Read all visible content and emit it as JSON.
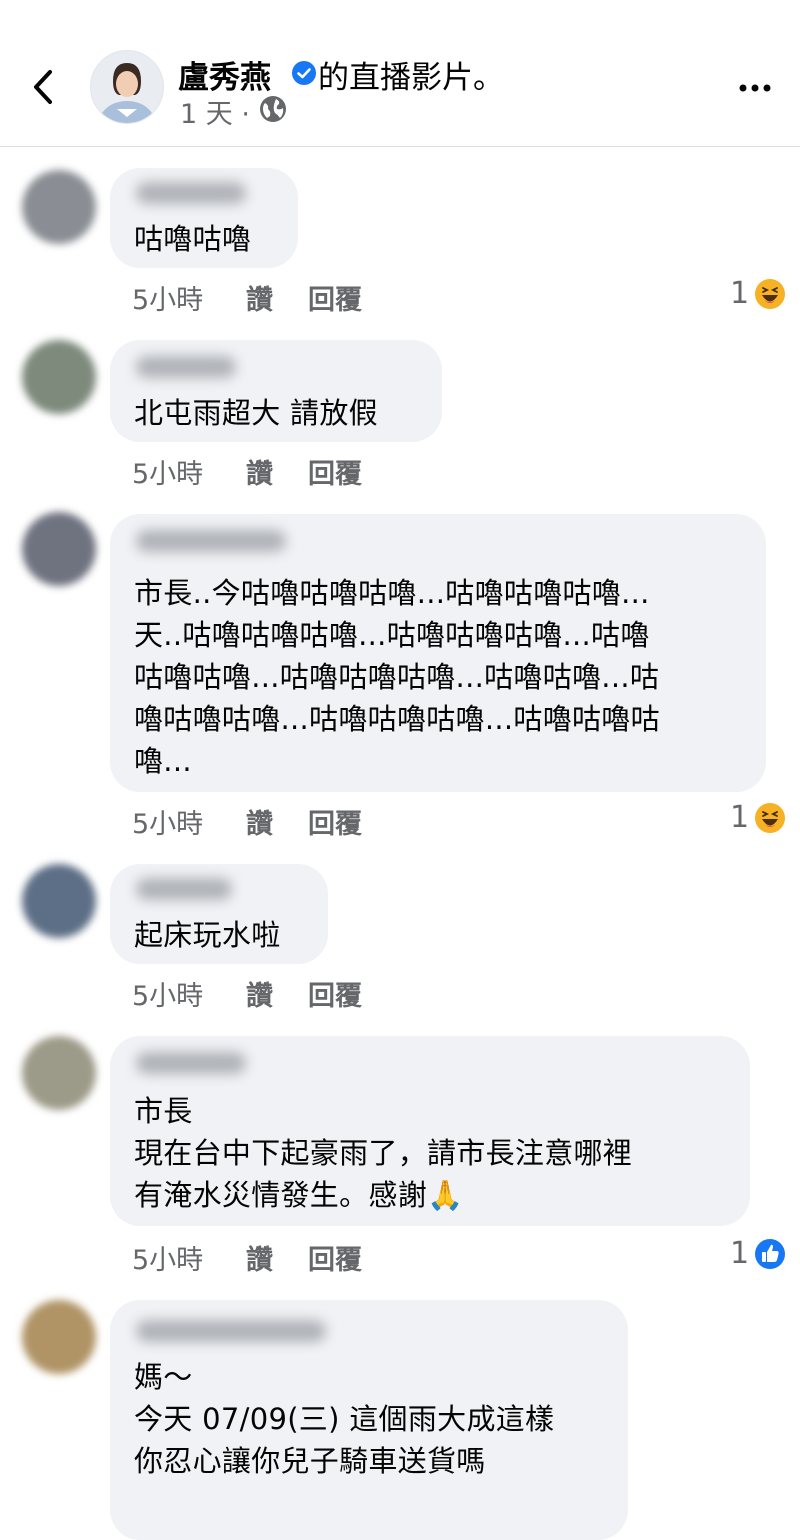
{
  "header": {
    "author": "盧秀燕",
    "title_suffix": "的直播影片。",
    "meta": "1 天 ·"
  },
  "comments": [
    {
      "text": "咕嚕咕嚕",
      "time": "5小時",
      "like": "讚",
      "reply": "回覆",
      "reaction_count": "1",
      "reaction": "haha-icon"
    },
    {
      "text": "北屯雨超大 請放假",
      "time": "5小時",
      "like": "讚",
      "reply": "回覆"
    },
    {
      "text": "市長..今咕嚕咕嚕咕嚕...咕嚕咕嚕咕嚕...\n天..咕嚕咕嚕咕嚕...咕嚕咕嚕咕嚕...咕嚕\n咕嚕咕嚕...咕嚕咕嚕咕嚕...咕嚕咕嚕...咕\n嚕咕嚕咕嚕...咕嚕咕嚕咕嚕...咕嚕咕嚕咕\n嚕...",
      "time": "5小時",
      "like": "讚",
      "reply": "回覆",
      "reaction_count": "1",
      "reaction": "haha-icon"
    },
    {
      "text": "起床玩水啦",
      "time": "5小時",
      "like": "讚",
      "reply": "回覆"
    },
    {
      "text": "市長\n現在台中下起豪雨了，請市長注意哪裡\n有淹水災情發生。感謝🙏",
      "time": "5小時",
      "like": "讚",
      "reply": "回覆",
      "reaction_count": "1",
      "reaction": "like-icon"
    },
    {
      "text": "媽～\n今天 07/09(三) 這個雨大成這樣\n你忍心讓你兒子騎車送貨嗎"
    }
  ],
  "colors": {
    "accent": "#1877f2",
    "bubble": "#f0f2f5",
    "secondary_text": "#65676b",
    "haha": "#f7b125"
  }
}
